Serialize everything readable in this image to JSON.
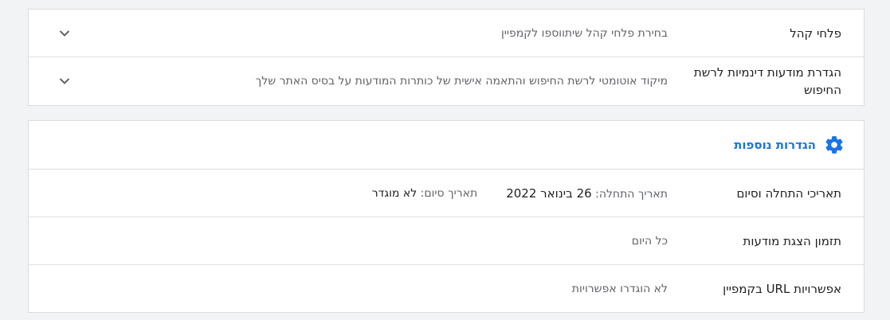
{
  "top_card": {
    "rows": [
      {
        "label": "פלחי קהל",
        "value": "בחירת פלחי קהל שיתווספו לקמפיין",
        "expand_icon": "chevron-down-icon"
      },
      {
        "label": "הגדרת מודעות דינמיות לרשת החיפוש",
        "value": "מיקוד אוטומטי לרשת החיפוש והתאמה אישית של כותרות המודעות על בסיס האתר שלך",
        "expand_icon": "chevron-down-icon"
      }
    ]
  },
  "additional_settings": {
    "icon": "gear-icon",
    "title": "הגדרות נוספות",
    "accent_color": "#1a73e8",
    "dates": {
      "label": "תאריכי התחלה וסיום",
      "start_prefix": "תאריך התחלה:",
      "start_value": "26 בינואר 2022",
      "end_prefix": "תאריך סיום:",
      "end_value": "לא מוגדר"
    },
    "ad_schedule": {
      "label": "תזמון הצגת מודעות",
      "value": "כל היום"
    },
    "url_options": {
      "label": "אפשרויות URL בקמפיין",
      "value": "לא הוגדרו אפשרויות"
    }
  }
}
